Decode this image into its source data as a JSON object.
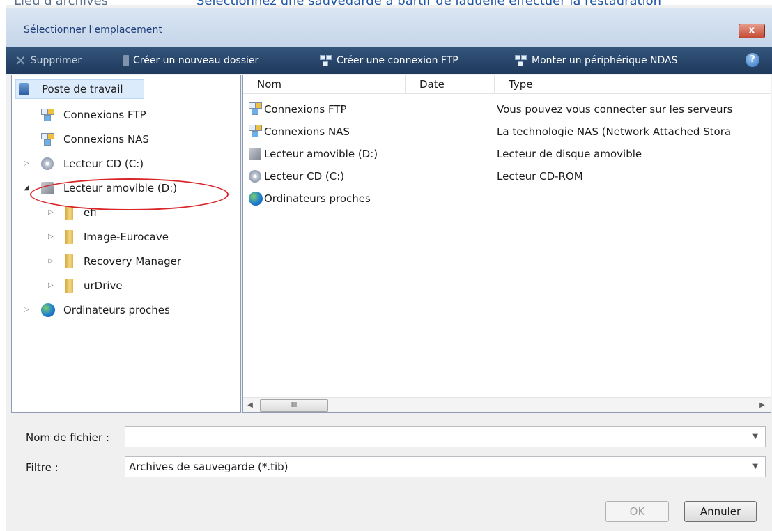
{
  "background": {
    "left_text": "Lieu d'archives",
    "right_text": "Sélectionnez une sauvegarde à partir de laquelle effectuer la restauration"
  },
  "window": {
    "title": "Sélectionner l'emplacement",
    "close_label": "x"
  },
  "toolbar": {
    "delete_label": "Supprimer",
    "new_folder_label": "Créer un nouveau dossier",
    "ftp_label": "Créer une connexion FTP",
    "nas_label": "Monter un périphérique NDAS",
    "help_label": "?"
  },
  "tree": {
    "root": "Poste de travail",
    "ftp": "Connexions FTP",
    "nas": "Connexions NAS",
    "cd": "Lecteur CD (C:)",
    "removable": "Lecteur amovible (D:)",
    "folders": [
      "efi",
      "Image-Eurocave",
      "Recovery Manager",
      "urDrive"
    ],
    "nearby": "Ordinateurs proches"
  },
  "list": {
    "columns": [
      "Nom",
      "Date",
      "Type"
    ],
    "rows": [
      {
        "name": "Connexions FTP",
        "date": "",
        "type": "Vous pouvez vous connecter sur les serveurs"
      },
      {
        "name": "Connexions NAS",
        "date": "",
        "type": "La technologie NAS (Network Attached Stora"
      },
      {
        "name": "Lecteur amovible (D:)",
        "date": "",
        "type": "Lecteur de disque amovible"
      },
      {
        "name": "Lecteur CD (C:)",
        "date": "",
        "type": "Lecteur CD-ROM"
      },
      {
        "name": "Ordinateurs proches",
        "date": "",
        "type": ""
      }
    ],
    "scroll_thumb": "III"
  },
  "form": {
    "filename_label": "Nom de fichier :",
    "filename_value": "",
    "filter_label_pre": "Fi",
    "filter_label_u": "l",
    "filter_label_post": "tre :",
    "filter_value": "Archives de sauvegarde (*.tib)"
  },
  "buttons": {
    "ok_pre": "O",
    "ok_u": "K",
    "cancel_u": "A",
    "cancel_post": "nnuler"
  },
  "colors": {
    "toolbar_bg": "#1f3a5c",
    "highlight_ellipse": "#d9262b",
    "selection_bg": "#dcebfc"
  }
}
